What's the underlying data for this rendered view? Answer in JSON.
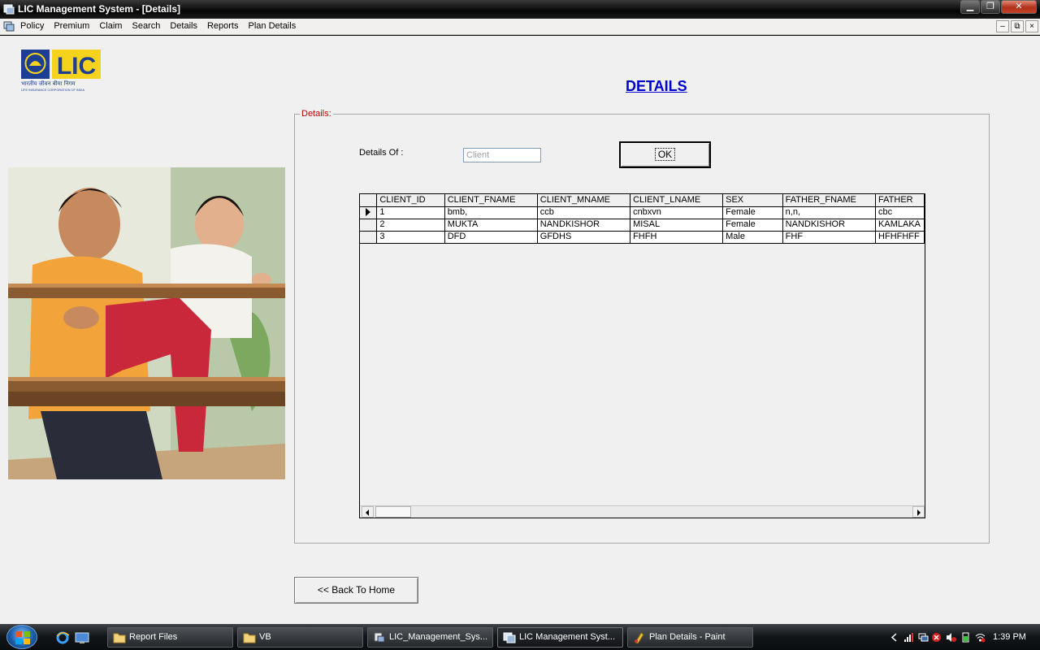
{
  "window": {
    "title": "LIC Management System - [Details]"
  },
  "menu": [
    "Policy",
    "Premium",
    "Claim",
    "Search",
    "Details",
    "Reports",
    "Plan Details"
  ],
  "mdi_controls": [
    "–",
    "⧉",
    "×"
  ],
  "logo": {
    "text": "LIC",
    "subtext": "भारतीय जीवन बीमा निगम",
    "subtext2": "LIFE INSURANCE CORPORATION OF INDIA"
  },
  "page": {
    "title": "DETAILS",
    "frame_legend": "Details:",
    "details_of_label": "Details Of :",
    "details_of_value": "Client",
    "ok_label": "OK",
    "back_label": "<< Back To Home"
  },
  "grid": {
    "columns": [
      "CLIENT_ID",
      "CLIENT_FNAME",
      "CLIENT_MNAME",
      "CLIENT_LNAME",
      "SEX",
      "FATHER_FNAME",
      "FATHER"
    ],
    "rows": [
      [
        "1",
        "bmb,",
        "ccb",
        "cnbxvn",
        "Female",
        "n,n,",
        "cbc"
      ],
      [
        "2",
        "MUKTA",
        "NANDKISHOR",
        "MISAL",
        "Female",
        "NANDKISHOR",
        "KAMLAKA"
      ],
      [
        "3",
        "DFD",
        "GFDHS",
        "FHFH",
        "Male",
        "FHF",
        "HFHFHFF"
      ]
    ],
    "current_row": 0
  },
  "taskbar": {
    "items": [
      {
        "label": "Report Files",
        "icon": "folder-icon",
        "active": false
      },
      {
        "label": "VB",
        "icon": "folder-icon",
        "active": false
      },
      {
        "label": "LIC_Management_Sys...",
        "icon": "vb-project-icon",
        "active": false
      },
      {
        "label": "LIC Management Syst...",
        "icon": "app-window-icon",
        "active": true
      },
      {
        "label": "Plan Details - Paint",
        "icon": "paint-icon",
        "active": false
      }
    ],
    "clock": "1:39 PM"
  },
  "colors": {
    "title_link": "#0000cc",
    "legend": "#c00000",
    "lic_blue": "#1c3f94",
    "lic_yellow": "#f5d21c"
  }
}
